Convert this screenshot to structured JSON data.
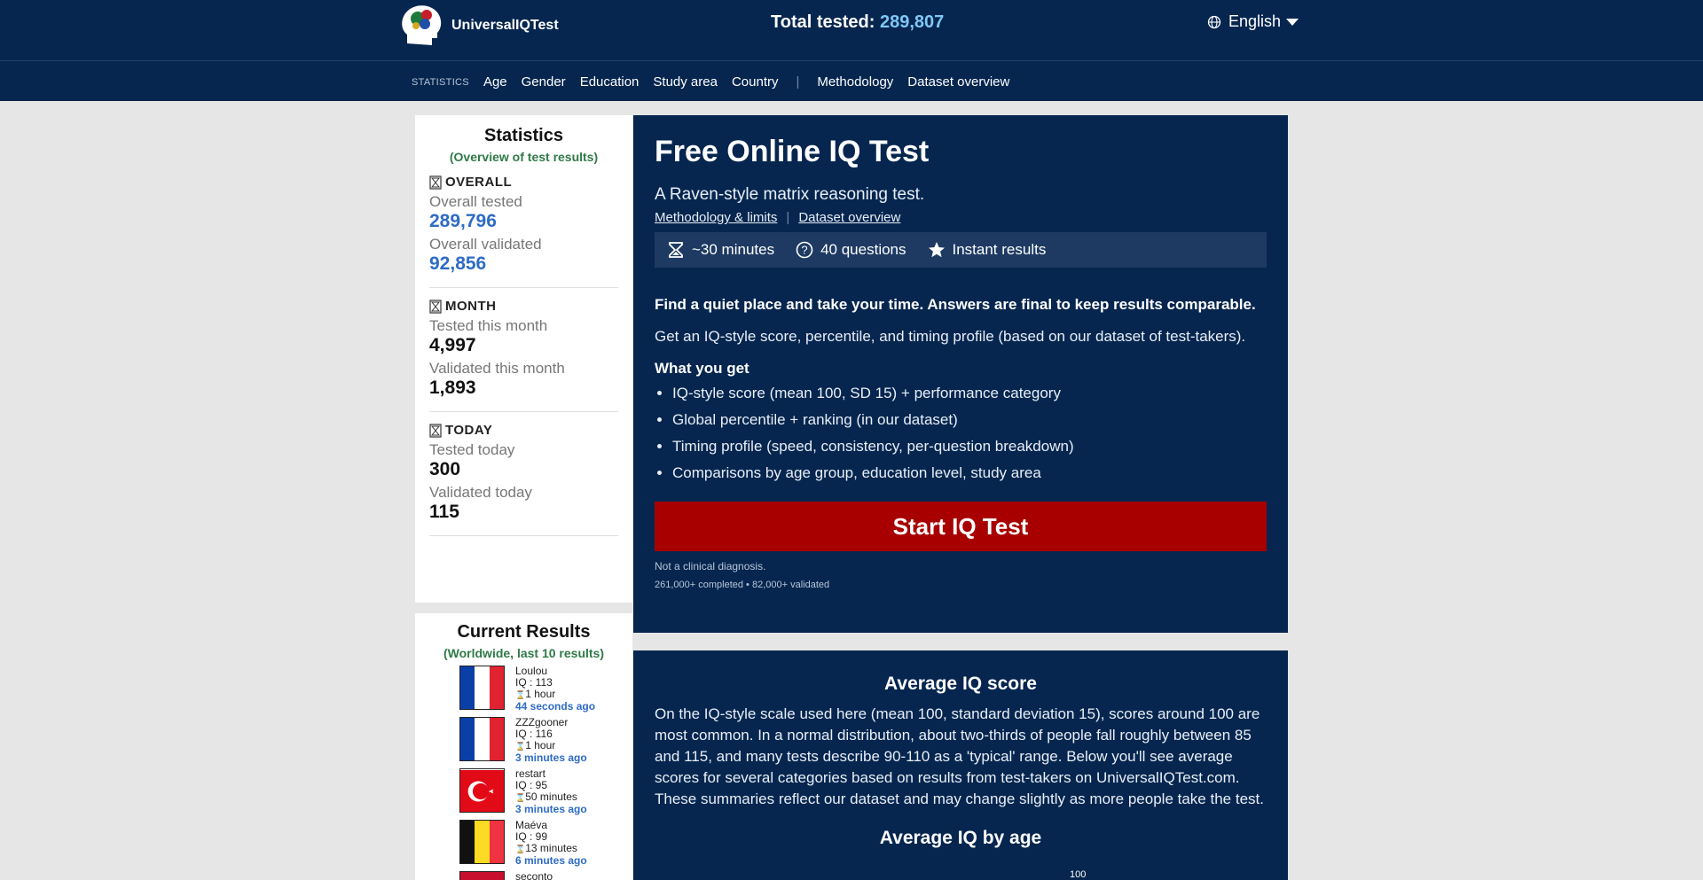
{
  "header": {
    "logo_text": "UniversalIQTest",
    "total_label": "Total tested:",
    "total_value": "289,807",
    "language": "English"
  },
  "nav": {
    "section_label": "STATISTICS",
    "items": [
      "Age",
      "Gender",
      "Education",
      "Study area",
      "Country"
    ],
    "extra": [
      "Methodology",
      "Dataset overview"
    ]
  },
  "stats": {
    "title": "Statistics",
    "subtitle": "(Overview of test results)",
    "overall": {
      "heading": "OVERALL",
      "tested_label": "Overall tested",
      "tested_value": "289,796",
      "validated_label": "Overall validated",
      "validated_value": "92,856"
    },
    "month": {
      "heading": "MONTH",
      "tested_label": "Tested this month",
      "tested_value": "4,997",
      "validated_label": "Validated this month",
      "validated_value": "1,893"
    },
    "today": {
      "heading": "TODAY",
      "tested_label": "Tested today",
      "tested_value": "300",
      "validated_label": "Validated today",
      "validated_value": "115"
    }
  },
  "results": {
    "title": "Current Results",
    "subtitle": "(Worldwide, last 10 results)",
    "items": [
      {
        "name": "Loulou",
        "iq": "IQ : 113",
        "duration": "1 hour",
        "ago": "44 seconds ago",
        "flag": [
          "#0b3fa8",
          "#ffffff",
          "#e1232f"
        ]
      },
      {
        "name": "ZZZgooner",
        "iq": "IQ : 116",
        "duration": "1 hour",
        "ago": "3 minutes ago",
        "flag": [
          "#0b3fa8",
          "#ffffff",
          "#e1232f"
        ]
      },
      {
        "name": "restart",
        "iq": "IQ : 95",
        "duration": "50 minutes",
        "ago": "3 minutes ago",
        "flag": [
          "#e30a17"
        ]
      },
      {
        "name": "Maéva",
        "iq": "IQ : 99",
        "duration": "13 minutes",
        "ago": "6 minutes ago",
        "flag": [
          "#111111",
          "#fdda24",
          "#ef3340"
        ]
      },
      {
        "name": "seconto",
        "iq": "",
        "duration": "",
        "ago": "",
        "flag": [
          "#c8102e"
        ]
      }
    ]
  },
  "main": {
    "title": "Free Online IQ Test",
    "tagline": "A Raven-style matrix reasoning test.",
    "link1": "Methodology & limits",
    "link2": "Dataset overview",
    "pill1": "~30 minutes",
    "pill2": "40 questions",
    "pill3": "Instant results",
    "intro": "Find a quiet place and take your time. Answers are final to keep results comparable.",
    "para": "Get an IQ-style score, percentile, and timing profile (based on our dataset of test-takers).",
    "wyg_title": "What you get",
    "bullets": [
      "IQ-style score (mean 100, SD 15) + performance category",
      "Global percentile + ranking (in our dataset)",
      "Timing profile (speed, consistency, per-question breakdown)",
      "Comparisons by age group, education level, study area"
    ],
    "cta": "Start IQ Test",
    "note1": "Not a clinical diagnosis.",
    "note2": "261,000+ completed • 82,000+ validated"
  },
  "average": {
    "title": "Average IQ score",
    "text": "On the IQ-style scale used here (mean 100, standard deviation 15), scores around 100 are most common. In a normal distribution, about two-thirds of people fall roughly between 85 and 115, and many tests describe 90-110 as a 'typical' range. Below you'll see average scores for several categories based on results from test-takers on UniversalIQTest.com. These summaries reflect our dataset and may change slightly as more people take the test.",
    "subtitle": "Average IQ by age",
    "tick": "100"
  }
}
